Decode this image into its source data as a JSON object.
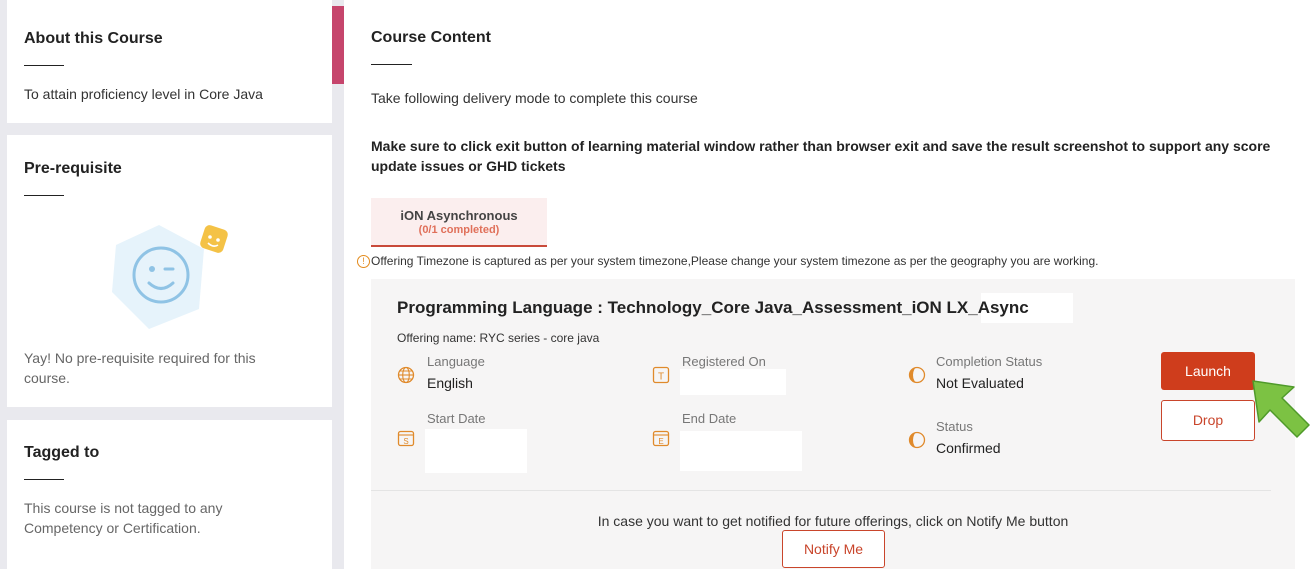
{
  "about": {
    "title": "About this Course",
    "text": "To attain proficiency level in Core Java"
  },
  "prereq": {
    "title": "Pre-requisite",
    "text": "Yay! No pre-requisite required for this course."
  },
  "tagged": {
    "title": "Tagged to",
    "text": "This course is not tagged to any Competency or Certification."
  },
  "content": {
    "title": "Course Content",
    "delivery_text": "Take following delivery mode to complete this course",
    "note": "Make sure to click exit button of learning material window rather than browser exit and save the result screenshot to support any score update issues or GHD tickets",
    "tab": {
      "label": "iON Asynchronous",
      "count": "(0/1 completed)"
    },
    "timezone_note": "Offering Timezone is captured as per your system timezone,Please change your system timezone as per the geography you are working."
  },
  "offering": {
    "title": "Programming Language : Technology_Core Java_Assessment_iON LX_Async",
    "offering_name": "Offering name: RYC series - core java",
    "language_label": "Language",
    "language_value": "English",
    "registered_label": "Registered On",
    "completion_label": "Completion Status",
    "completion_value": "Not Evaluated",
    "start_label": "Start Date",
    "end_label": "End Date",
    "status_label": "Status",
    "status_value": "Confirmed",
    "launch_label": "Launch",
    "drop_label": "Drop",
    "notify_text": "In case you want to get notified for future offerings, click on Notify Me button",
    "notify_label": "Notify Me"
  },
  "colors": {
    "accent": "#c6456c",
    "primary_button": "#cf3d1c",
    "arrow": "#7cc243"
  }
}
